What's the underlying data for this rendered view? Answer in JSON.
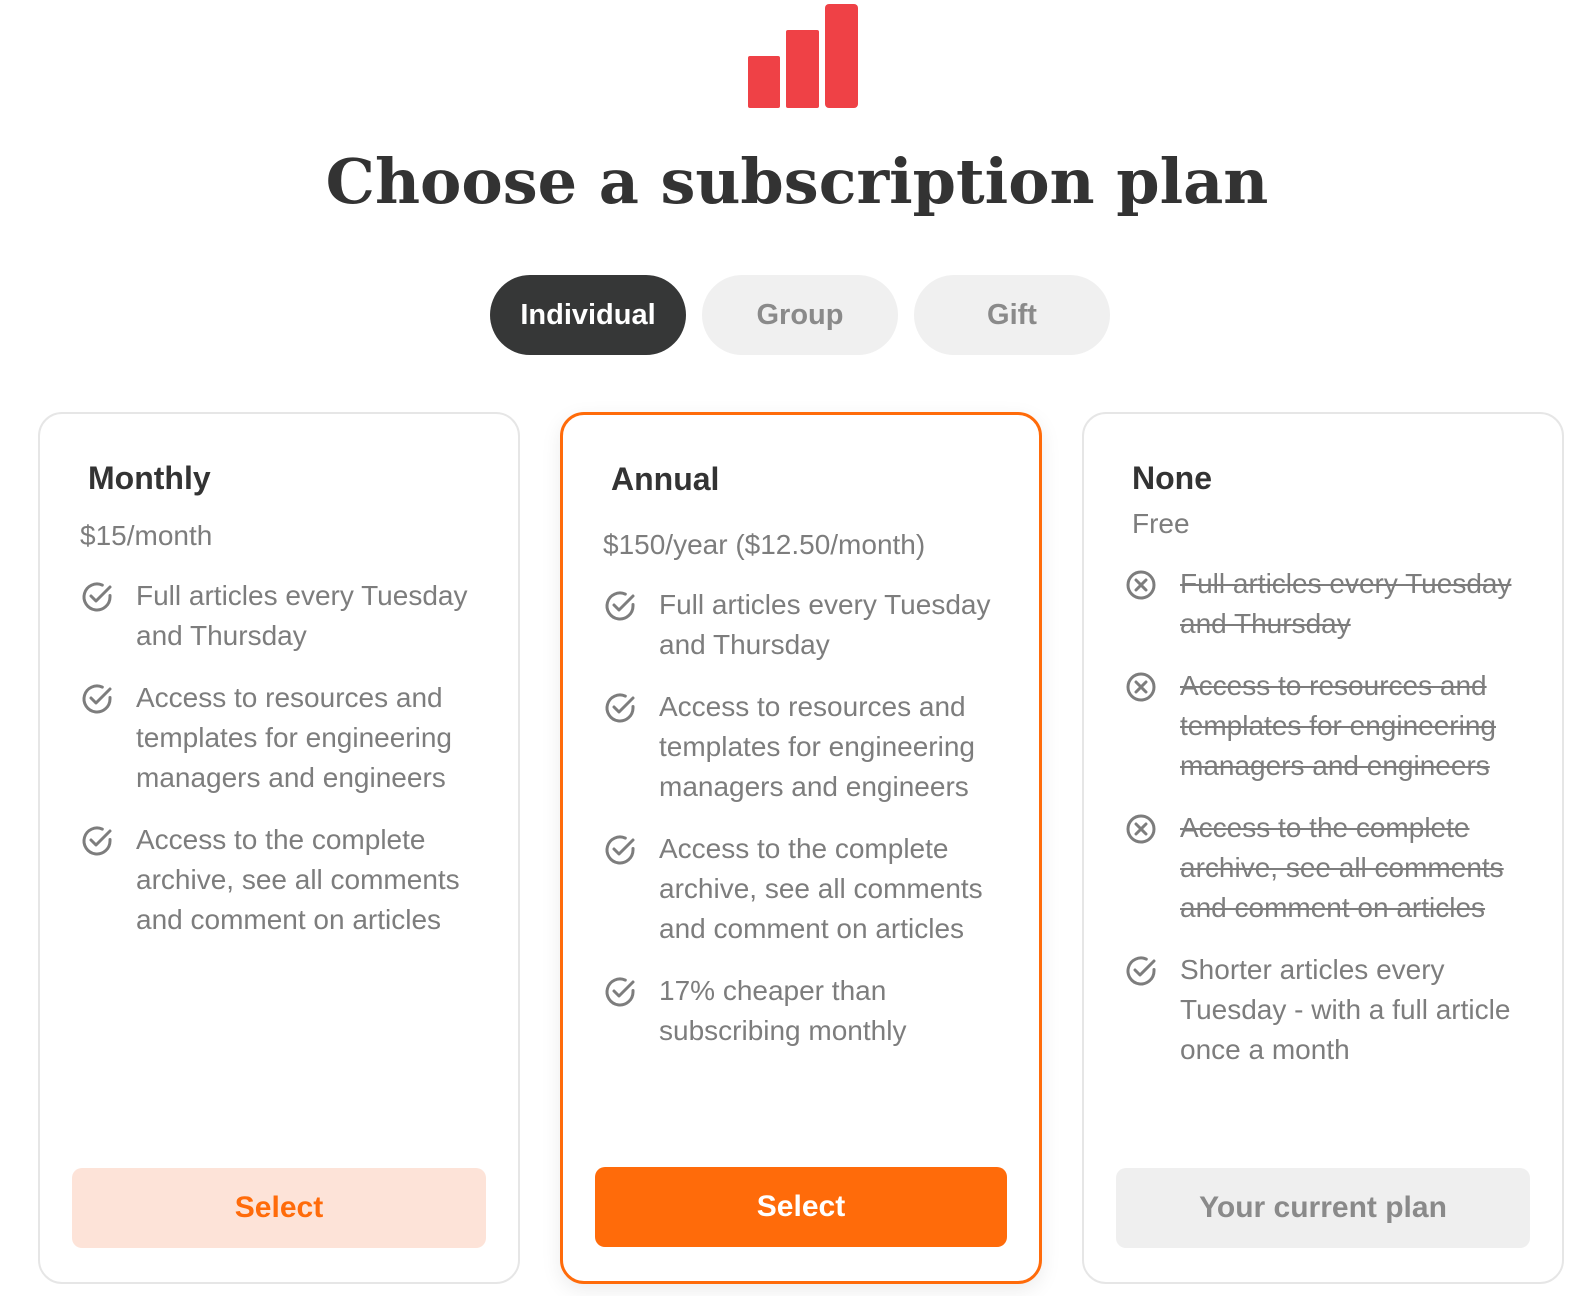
{
  "brand": {
    "logo_icon": "bar-chart-logo-icon",
    "logo_color": "#ef4146"
  },
  "title": "Choose a subscription plan",
  "tabs": [
    {
      "label": "Individual",
      "active": true
    },
    {
      "label": "Group",
      "active": false
    },
    {
      "label": "Gift",
      "active": false
    }
  ],
  "colors": {
    "accent": "#ff6b0a",
    "accent_light": "#fde3d8",
    "dark_pill": "#363737",
    "muted_text": "#7d7d7d"
  },
  "plans": [
    {
      "name": "Monthly",
      "price": "$15/month",
      "features": [
        {
          "text": "Full articles every Tuesday and Thursday",
          "icon": "check-circle-icon"
        },
        {
          "text": "Access to resources and templates for engineering managers and engineers",
          "icon": "check-circle-icon"
        },
        {
          "text": "Access to the complete archive, see all comments and comment on articles",
          "icon": "check-circle-icon"
        }
      ],
      "button_label": "Select"
    },
    {
      "name": "Annual",
      "price": "$150/year ($12.50/month)",
      "features": [
        {
          "text": "Full articles every Tuesday and Thursday",
          "icon": "check-circle-icon"
        },
        {
          "text": "Access to resources and templates for engineering managers and engineers",
          "icon": "check-circle-icon"
        },
        {
          "text": "Access to the complete archive, see all comments and comment on articles",
          "icon": "check-circle-icon"
        },
        {
          "text": "17% cheaper than subscribing monthly",
          "icon": "check-circle-icon"
        }
      ],
      "button_label": "Select"
    },
    {
      "name": "None",
      "price": "Free",
      "features": [
        {
          "text": "Full articles every Tuesday and Thursday",
          "icon": "x-circle-icon"
        },
        {
          "text": "Access to resources and templates for engineering managers and engineers",
          "icon": "x-circle-icon"
        },
        {
          "text": "Access to the complete archive, see all comments and comment on articles",
          "icon": "x-circle-icon"
        },
        {
          "text": "Shorter articles every Tuesday - with a full article once a month",
          "icon": "check-circle-icon"
        }
      ],
      "button_label": "Your current plan"
    }
  ]
}
